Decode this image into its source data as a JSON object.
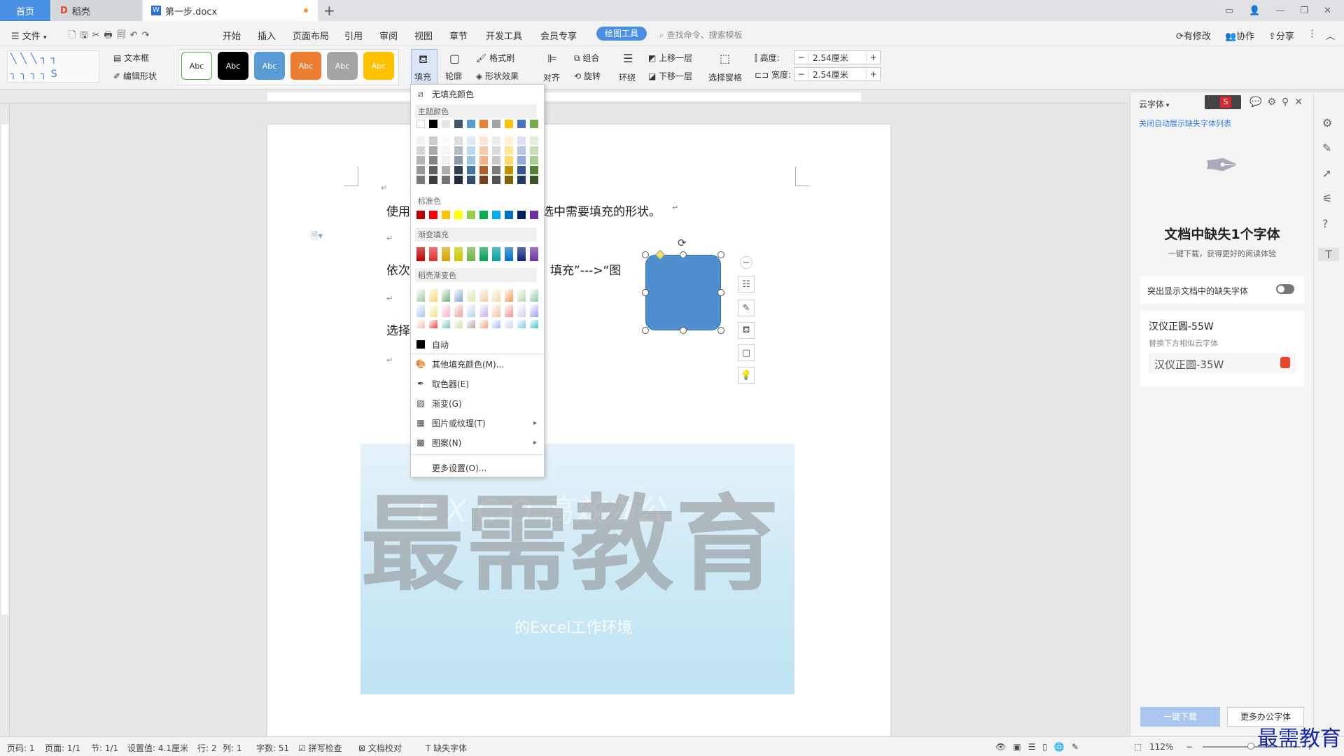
{
  "tabs": {
    "home": "首页",
    "docer": "稻壳",
    "doc": "第一步.docx"
  },
  "menu": {
    "file": "文件",
    "items": [
      "开始",
      "插入",
      "页面布局",
      "引用",
      "审阅",
      "视图",
      "章节",
      "开发工具",
      "会员专享"
    ],
    "drawing_tools": "绘图工具",
    "search_placeholder": "查找命令、搜索模板",
    "right": {
      "changes": "有修改",
      "collab": "协作",
      "share": "分享"
    }
  },
  "ribbon": {
    "textbox": "文本框",
    "edit_shape": "编辑形状",
    "style_label": "Abc",
    "fill": "填充",
    "outline": "轮廓",
    "format_painter": "格式刷",
    "shape_effects": "形状效果",
    "align": "对齐",
    "group": "组合",
    "rotate": "旋转",
    "wrap": "环绕",
    "bring_forward": "上移一层",
    "send_backward": "下移一层",
    "selection_pane": "选择窗格",
    "height_label": "高度:",
    "width_label": "宽度:",
    "height_value": "2.54厘米",
    "width_value": "2.54厘米"
  },
  "document": {
    "line1a": "使用 W",
    "line1b": "选中需要填充的形状。",
    "line2a": "依次点",
    "line2b": "填充”--->“图",
    "line3a": "选择",
    "banner_big": "最需教育",
    "banner_top": "E X C O  高效办公",
    "banner_sub": "的Excel工作环境"
  },
  "dropdown": {
    "no_fill": "无填充颜色",
    "theme_colors": "主题颜色",
    "standard_colors": "标准色",
    "gradient_fill": "渐变填充",
    "docer_gradient": "稻壳渐变色",
    "auto": "自动",
    "more_colors": "其他填充颜色(M)...",
    "eyedropper": "取色器(E)",
    "gradient": "渐变(G)",
    "picture_texture": "图片或纹理(T)",
    "pattern": "图案(N)",
    "more_settings": "更多设置(O)...",
    "theme_top": [
      "#ffffff",
      "#000000",
      "#e7e6e6",
      "#44546a",
      "#5b9bd5",
      "#ed7d31",
      "#a5a5a5",
      "#ffc000",
      "#4472c4",
      "#70ad47"
    ],
    "standard": [
      "#c00000",
      "#ff0000",
      "#ffc000",
      "#ffff00",
      "#92d050",
      "#00b050",
      "#00b0f0",
      "#0070c0",
      "#002060",
      "#7030a0"
    ],
    "gradient_row": [
      "#c00000",
      "#e0302e",
      "#d8a200",
      "#c8c800",
      "#70b040",
      "#00a050",
      "#00a0a0",
      "#0070c0",
      "#102080",
      "#7030a0"
    ]
  },
  "right_panel": {
    "cloud_font": "云字体",
    "close_auto": "关闭自动展示缺失字体列表",
    "missing_title": "文档中缺失1个字体",
    "missing_sub": "一键下载，获得更好的阅读体验",
    "highlight_toggle": "突出显示文档中的缺失字体",
    "font_name": "汉仪正圆-55W",
    "replace_hint": "替换下方相似云字体",
    "replacement": "汉仪正圆-35W",
    "download_btn": "一键下载",
    "more_fonts_btn": "更多办公字体"
  },
  "status": {
    "page_code": "页码: 1",
    "pages": "页面: 1/1",
    "section": "节: 1/1",
    "setting": "设置值: 4.1厘米",
    "row": "行: 2",
    "col": "列: 1",
    "words": "字数: 51",
    "spell": "拼写检查",
    "proof": "文档校对",
    "missing_font": "缺失字体",
    "zoom": "112%"
  },
  "watermark": "最需教育"
}
